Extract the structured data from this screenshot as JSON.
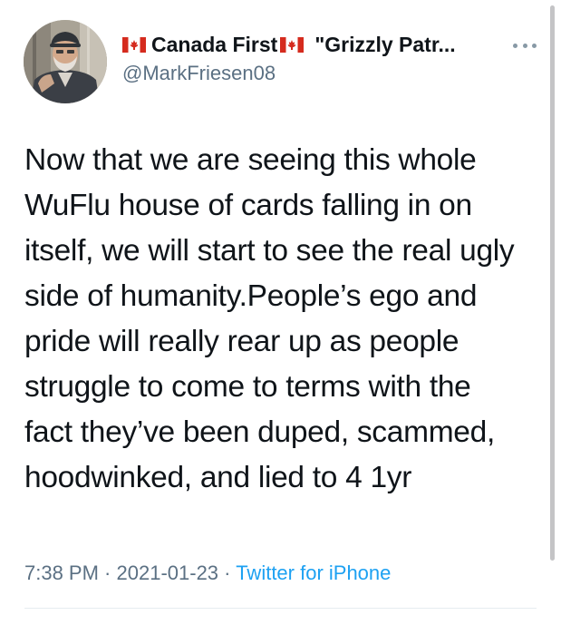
{
  "author": {
    "display_name_part1": "Canada First",
    "display_name_part2": "\"Grizzly Patr...",
    "handle": "@MarkFriesen08"
  },
  "tweet": {
    "text_lines": [
      "Now that we are seeing this whole",
      "WuFlu house of cards falling in on",
      "itself, we will start to see the real ugly",
      "side of humanity.People’s ego and",
      "pride will really rear up as people",
      "struggle to come to terms with the",
      "fact they’ve been duped, scammed,",
      "hoodwinked, and lied to 4 1yr"
    ]
  },
  "meta": {
    "time": "7:38 PM",
    "separator": " · ",
    "date": "2021-01-23",
    "source": "Twitter for iPhone"
  },
  "icons": {
    "flag": "canada-flag-icon",
    "more": "more-options-icon"
  },
  "colors": {
    "text": "#0f1419",
    "secondary": "#5b7083",
    "link": "#1da1f2",
    "flag_red": "#d52b1e"
  }
}
